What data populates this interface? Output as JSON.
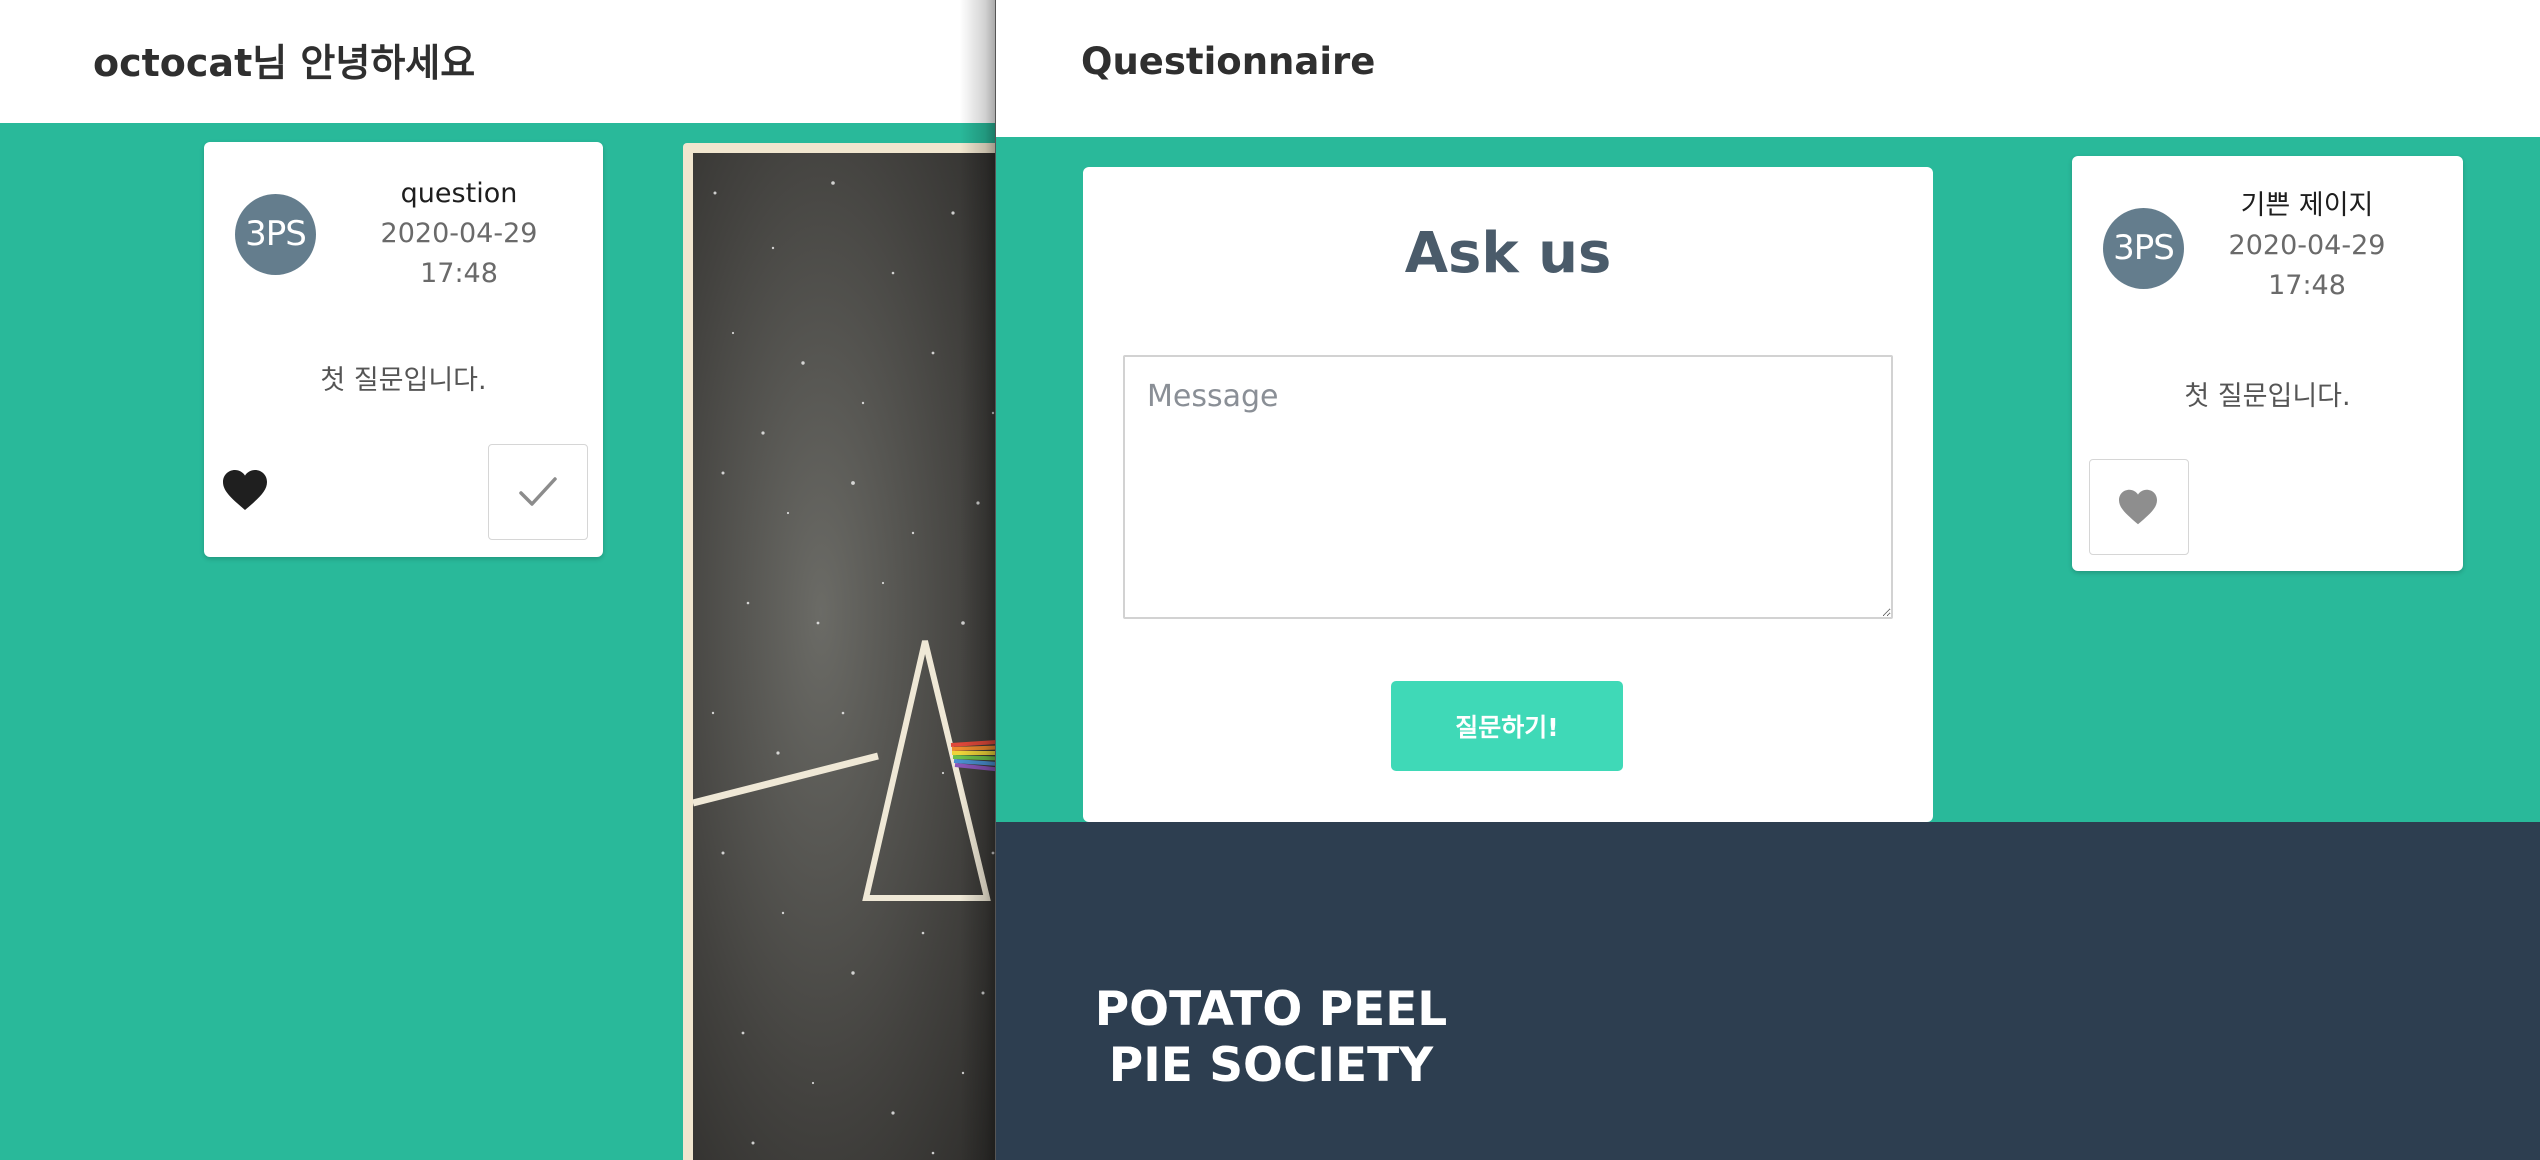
{
  "left_panel": {
    "greeting": "octocat님 안녕하세요",
    "card": {
      "avatar_text": "3PS",
      "title": "question",
      "date": "2020-04-29",
      "time": "17:48",
      "body": "첫 질문입니다.",
      "like_icon": "heart-icon",
      "check_icon": "check-icon"
    },
    "poster_icon": "prism-album-art"
  },
  "right_panel": {
    "title": "Questionnaire",
    "ask": {
      "heading": "Ask us",
      "message_placeholder": "Message",
      "message_value": "",
      "submit_label": "질문하기!"
    },
    "card": {
      "avatar_text": "3PS",
      "title": "기쁜 제이지",
      "date": "2020-04-29",
      "time": "17:48",
      "body": "첫 질문입니다.",
      "like_icon": "heart-icon"
    },
    "footer": {
      "brand_line1": "POTATO PEEL",
      "brand_line2": "PIE SOCIETY"
    }
  },
  "colors": {
    "teal_background": "#29b99a",
    "submit_button": "#3fd9b7",
    "footer": "#2d3e50",
    "avatar": "#647d8d",
    "heading_text": "#4a5b6a"
  }
}
